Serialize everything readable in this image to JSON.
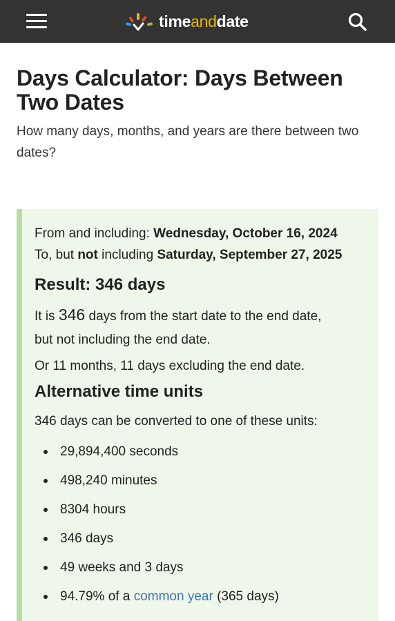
{
  "header": {
    "logo_text_start": "time",
    "logo_text_mid": "and",
    "logo_text_end": "date",
    "menu_icon": "hamburger-menu-icon",
    "search_icon": "search-icon",
    "background_color": "#333333",
    "accent_color": "#e6b800"
  },
  "page": {
    "title": "Days Calculator: Days Between Two Dates",
    "subtitle": "How many days, months, and years are there between two dates?"
  },
  "result": {
    "from_label": "From and including: ",
    "from_date": "Wednesday, October 16, 2024",
    "to_label_1": "To, but ",
    "to_label_not": "not",
    "to_label_2": " including ",
    "to_date": "Saturday, September 27, 2025",
    "heading": "Result: 346 days",
    "desc_prefix": "It is ",
    "desc_number": "346",
    "desc_suffix_1": " days from the start date to the end date,",
    "desc_suffix_2": "but not including the end date.",
    "alt_summary": "Or 11 months, 11 days excluding the end date."
  },
  "alternative": {
    "heading": "Alternative time units",
    "intro": "346 days can be converted to one of these units:",
    "units": [
      "29,894,400 seconds",
      "498,240 minutes",
      "8304 hours",
      "346 days",
      "49 weeks and 3 days"
    ],
    "year_prefix": "94.79% of a ",
    "year_link": "common year",
    "year_suffix": " (365 days)"
  },
  "colors": {
    "result_bg": "#eef7e9",
    "result_border": "#b9dca3",
    "link": "#3a73b8"
  }
}
